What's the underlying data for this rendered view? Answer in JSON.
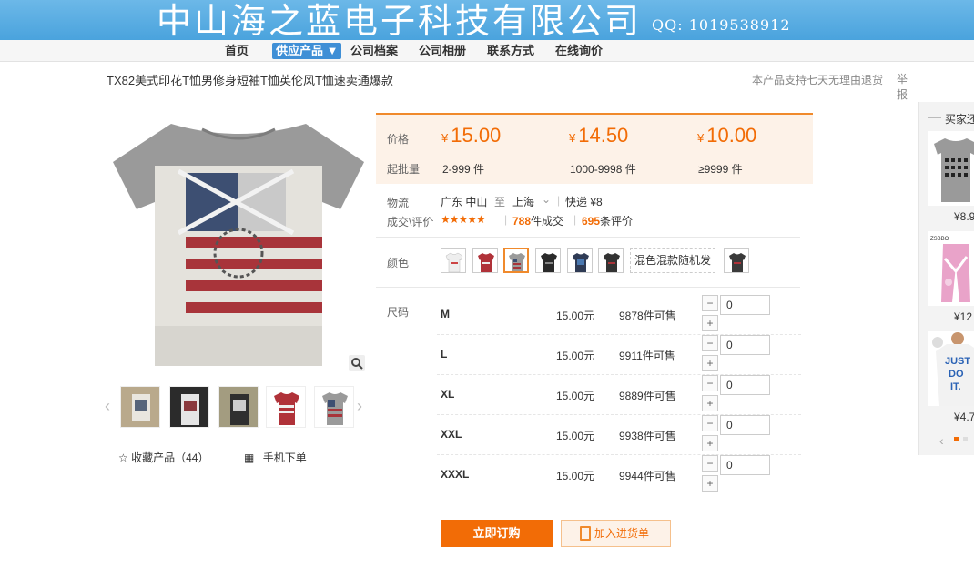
{
  "banner": {
    "company_name": "中山海之蓝电子科技有限公司",
    "qq": "QQ: 1019538912"
  },
  "nav": {
    "items": [
      "首页",
      "供应产品 ▼",
      "公司档案",
      "公司相册",
      "联系方式",
      "在线询价"
    ],
    "active_index": 1
  },
  "product": {
    "title": "TX82美式印花T恤男修身短袖T恤英伦风T恤速卖通爆款",
    "return_note": "本产品支持七天无理由退货",
    "report": "举报"
  },
  "price": {
    "price_label": "价格",
    "qty_label": "起批量",
    "currency": "¥",
    "tiers": [
      {
        "price": "15.00",
        "range": "2-999 件"
      },
      {
        "price": "14.50",
        "range": "1000-9998 件"
      },
      {
        "price": "10.00",
        "range": "≥9999 件"
      }
    ]
  },
  "logistics": {
    "label": "物流",
    "from": "广东 中山",
    "to_word": "至",
    "to": "上海",
    "dropdown_caret": "⌄",
    "express": "快递 ¥8"
  },
  "deals": {
    "label": "成交\\评价",
    "stars": "★★★★★",
    "sold_count": "788",
    "sold_suffix": "件成交",
    "review_count": "695",
    "review_suffix": "条评价"
  },
  "color": {
    "label": "颜色",
    "mixed_option": "混色混款随机发",
    "selected_index": 2
  },
  "size": {
    "label": "尺码",
    "rows": [
      {
        "name": "M",
        "price": "15.00元",
        "stock": "9878件可售",
        "qty": "0"
      },
      {
        "name": "L",
        "price": "15.00元",
        "stock": "9911件可售",
        "qty": "0"
      },
      {
        "name": "XL",
        "price": "15.00元",
        "stock": "9889件可售",
        "qty": "0"
      },
      {
        "name": "XXL",
        "price": "15.00元",
        "stock": "9938件可售",
        "qty": "0"
      },
      {
        "name": "XXXL",
        "price": "15.00元",
        "stock": "9944件可售",
        "qty": "0"
      }
    ]
  },
  "actions": {
    "order": "立即订购",
    "add_cart": "加入进货单",
    "favorite": "收藏产品（44）",
    "mobile": "手机下单"
  },
  "sidebar": {
    "title": "买家还",
    "prices": [
      "¥8.9",
      "¥12",
      "¥4.7"
    ]
  },
  "colors": {
    "accent": "#f26c06",
    "banner": "#4aa3dd",
    "nav_active": "#3f8fd6",
    "price_bg": "#fdf2e8"
  }
}
